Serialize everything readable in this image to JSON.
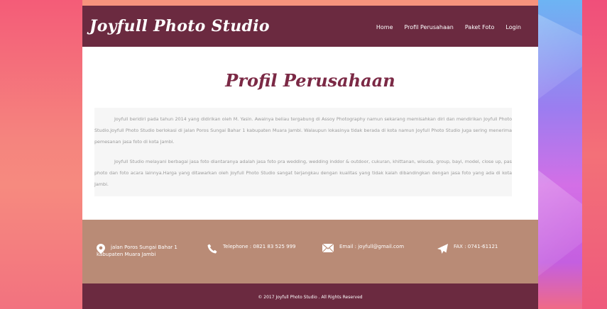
{
  "brand": {
    "name": "Joyfull Photo Studio"
  },
  "nav": {
    "items": [
      "Home",
      "Profil Perusahaan",
      "Paket Foto",
      "Login"
    ]
  },
  "page": {
    "title": "Profil Perusahaan",
    "paragraphs": [
      "Joyfull beridiri pada tahun 2014 yang didirikan oleh M. Yasin. Awalnya beliau tergabung di Assoy Photography namun sekarang memisahkan diri dan mendirikan Joyfull Photo Studio.Joyfull Photo Studio berlokasi di jalan Poros Sungai Bahar 1 kabupaten Muara Jambi. Walaupun lokasinya tidak berada di kota namun Joyfull Photo Studio juga sering menerima pemesanan jasa foto di kota Jambi.",
      "Joyfull Studio melayani berbagai jasa foto diantaranya adalah jasa foto pra wedding, wedding inddor & outdoor, cukuran, khittanan, wisuda, group, bayi, model, close up, pas photo dan foto acara lainnya.Harga yang ditawarkan oleh Joyfull Photo Studio sangat terjangkau dengan kualitas yang tidak kalah dibandingkan dengan jasa foto yang ada di kota Jambi."
    ]
  },
  "footer": {
    "address_line1": "jalan Poros Sungai Bahar 1",
    "address_line2": "kabupaten Muara Jambi",
    "telephone": "Telephone : 0821 83 525 999",
    "email": "Email : joyfull@gmail.com",
    "fax": "FAX : 0741-61121",
    "copyright": "© 2017 Joyfull Photo Studio . All Rights Reserved"
  },
  "colors": {
    "header": "#6b2a40",
    "accent_title": "#7b2945",
    "footer_top": "#b98b76"
  }
}
